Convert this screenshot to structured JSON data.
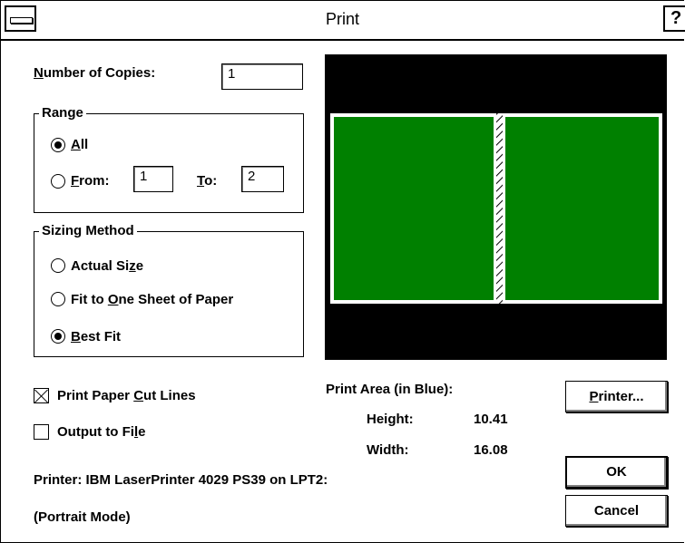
{
  "window": {
    "title": "Print",
    "help_glyph": "?"
  },
  "copies": {
    "label_prefix": "N",
    "label_rest": "umber of Copies:",
    "value": "1"
  },
  "range": {
    "title": "Range",
    "all_mnemonic": "A",
    "all_rest": "ll",
    "all_selected": true,
    "from_mnemonic": "F",
    "from_rest": "rom:",
    "from_value": "1",
    "to_mnemonic": "T",
    "to_rest": "o:",
    "to_value": "2"
  },
  "sizing": {
    "title": "Sizing Method",
    "actual_a": "Actual Si",
    "actual_m": "z",
    "actual_b": "e",
    "fit_a": "Fit to ",
    "fit_m": "O",
    "fit_b": "ne Sheet of Paper",
    "best_m": "B",
    "best_b": "est Fit",
    "selected": "Best Fit"
  },
  "options": {
    "cutlines_a": "Print Paper ",
    "cutlines_m": "C",
    "cutlines_b": "ut Lines",
    "cutlines_checked": true,
    "file_a": "Output to Fi",
    "file_m": "l",
    "file_b": "e",
    "file_checked": false
  },
  "print_area": {
    "title": "Print Area (in Blue):",
    "height_label": "Height:",
    "height_value": "10.41",
    "width_label": "Width:",
    "width_value": "16.08"
  },
  "printer_info": {
    "line1": "Printer:  IBM LaserPrinter 4029 PS39 on LPT2:",
    "line2": "(Portrait Mode)"
  },
  "buttons": {
    "printer_m": "P",
    "printer_rest": "rinter...",
    "ok": "OK",
    "cancel": "Cancel"
  },
  "colors": {
    "preview_bg": "#000000",
    "page_fill": "#008000",
    "page_border": "#ffffff"
  }
}
